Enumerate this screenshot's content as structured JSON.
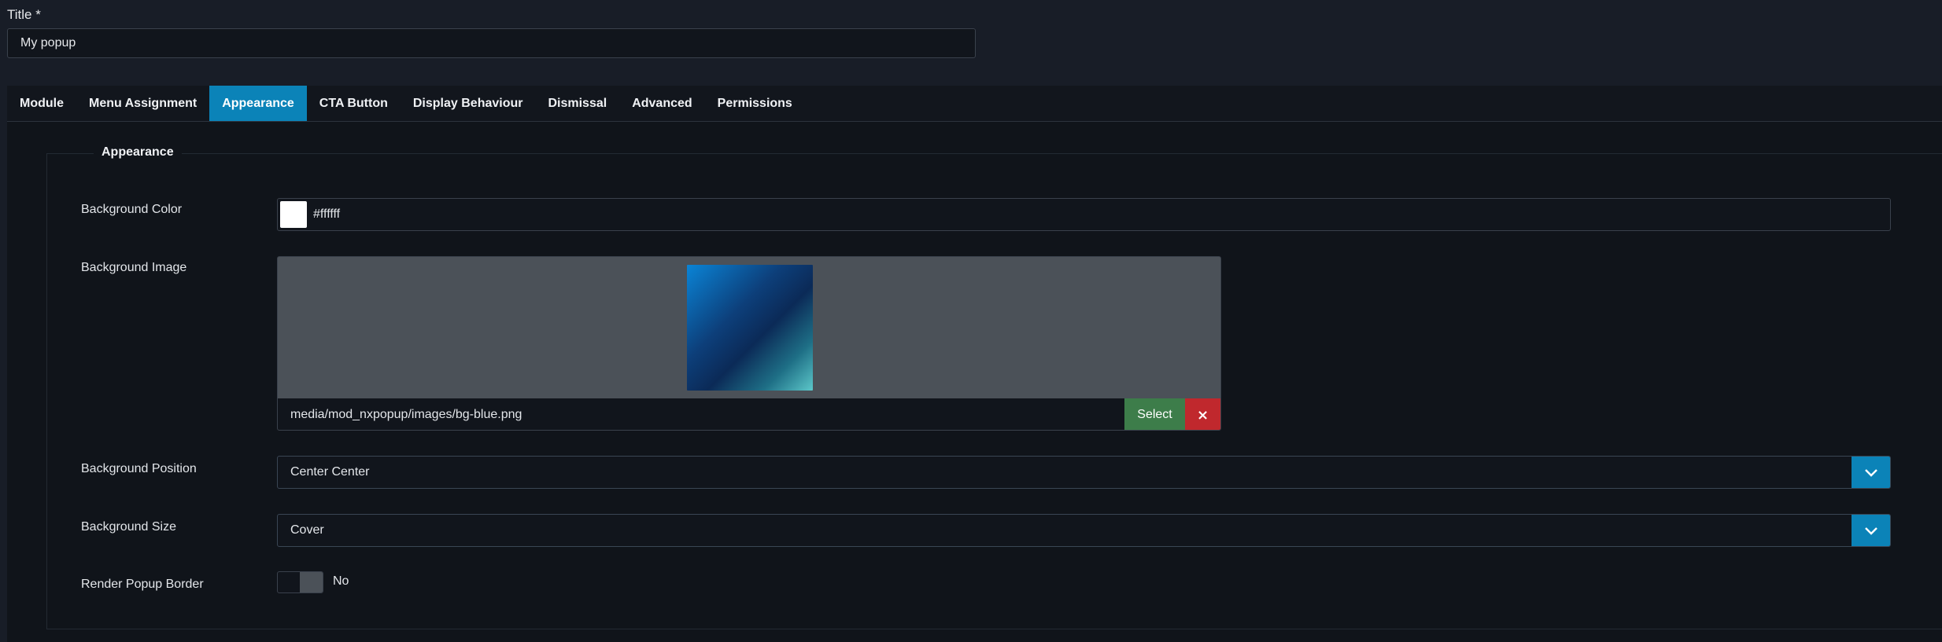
{
  "title_field": {
    "label": "Title *",
    "value": "My popup"
  },
  "tabs": [
    {
      "label": "Module",
      "active": false
    },
    {
      "label": "Menu Assignment",
      "active": false
    },
    {
      "label": "Appearance",
      "active": true
    },
    {
      "label": "CTA Button",
      "active": false
    },
    {
      "label": "Display Behaviour",
      "active": false
    },
    {
      "label": "Dismissal",
      "active": false
    },
    {
      "label": "Advanced",
      "active": false
    },
    {
      "label": "Permissions",
      "active": false
    }
  ],
  "appearance": {
    "legend": "Appearance",
    "background_color": {
      "label": "Background Color",
      "value": "#ffffff",
      "swatch": "#ffffff"
    },
    "background_image": {
      "label": "Background Image",
      "path": "media/mod_nxpopup/images/bg-blue.png",
      "select_label": "Select",
      "clear_label": "×"
    },
    "background_position": {
      "label": "Background Position",
      "value": "Center Center"
    },
    "background_size": {
      "label": "Background Size",
      "value": "Cover"
    },
    "render_border": {
      "label": "Render Popup Border",
      "state_text": "No",
      "on": false
    }
  },
  "colors": {
    "accent": "#0b83b8",
    "select_button": "#3d7d4a",
    "clear_button": "#c0282d",
    "background": "#181d27"
  },
  "icons": {
    "select_arrow": "chevron-down-icon",
    "clear": "close-icon"
  }
}
